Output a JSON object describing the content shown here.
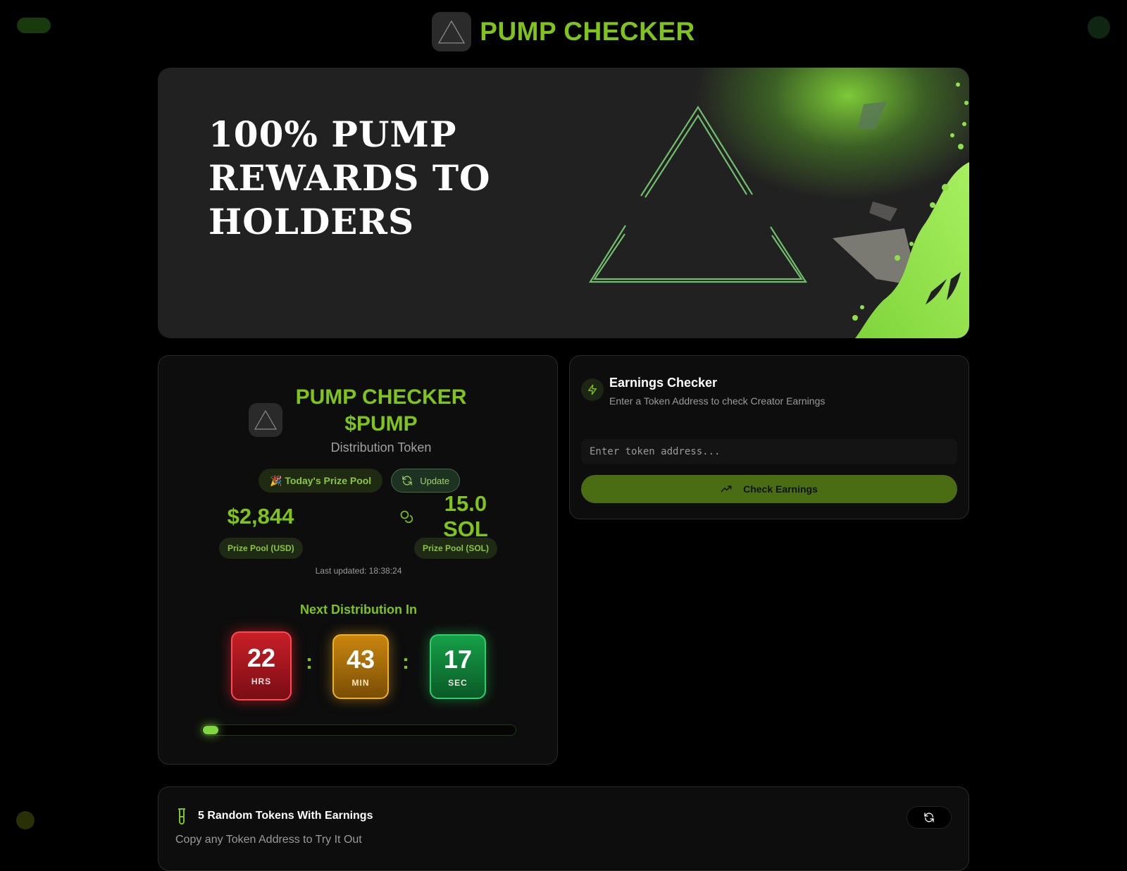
{
  "header": {
    "brand": "PUMP CHECKER"
  },
  "hero": {
    "title": "100% PUMP REWARDS TO HOLDERS"
  },
  "token_card": {
    "name": "PUMP CHECKER $PUMP",
    "subtitle": "Distribution Token",
    "prize_pool_label": "🎉 Today's Prize Pool",
    "update_label": "Update",
    "usd_value": "$2,844",
    "usd_label": "Prize Pool (USD)",
    "sol_value": "15.0 SOL",
    "sol_label": "Prize Pool (SOL)",
    "last_updated": "Last updated: 18:38:24",
    "next_distribution_label": "Next Distribution In",
    "countdown": {
      "hours": "22",
      "hours_label": "HRS",
      "minutes": "43",
      "minutes_label": "MIN",
      "seconds": "17",
      "seconds_label": "SEC",
      "separator": ":"
    },
    "progress_fraction": 0.05
  },
  "earnings_checker": {
    "title": "Earnings Checker",
    "subtitle": "Enter a Token Address to check Creator Earnings",
    "input_placeholder": "Enter token address...",
    "input_value": "",
    "button_label": "Check Earnings"
  },
  "random_tokens": {
    "title": "5 Random Tokens With Earnings",
    "subtitle": "Copy any Token Address to Try It Out"
  },
  "colors": {
    "accent": "#7fc41a",
    "background": "#000000",
    "card": "#0d0d0d",
    "hours_tile": "#c81f27",
    "minutes_tile": "#c9860e",
    "seconds_tile": "#15a048"
  },
  "icons": {
    "logo": "triangle-logo-icon",
    "update": "refresh-icon",
    "sol": "coins-icon",
    "earnings": "lightning-icon",
    "button": "trending-up-icon",
    "random": "test-tube-icon",
    "refresh": "refresh-icon"
  }
}
